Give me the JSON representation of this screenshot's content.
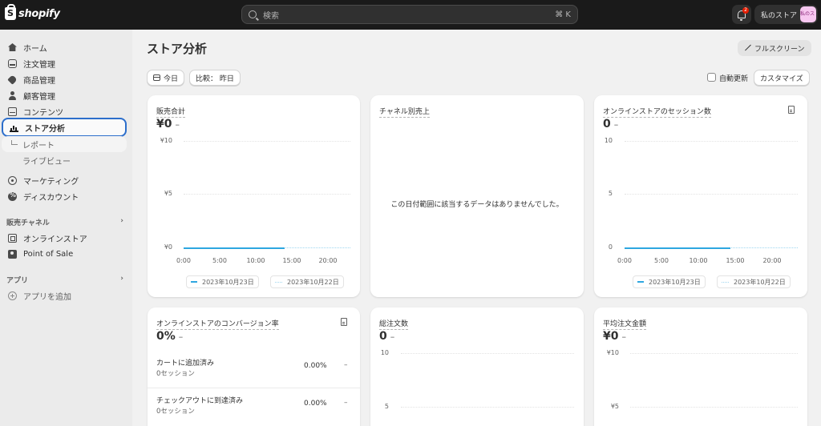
{
  "topbar": {
    "logo_text": "shopify",
    "search_placeholder": "検索",
    "search_shortcut": "⌘ K",
    "notification_count": "2",
    "store_name": "私のストア",
    "store_avatar": "私のストア"
  },
  "sidebar": {
    "items": [
      {
        "label": "ホーム",
        "icon": "home-icon"
      },
      {
        "label": "注文管理",
        "icon": "inbox-icon"
      },
      {
        "label": "商品管理",
        "icon": "tag-icon"
      },
      {
        "label": "顧客管理",
        "icon": "person-icon"
      },
      {
        "label": "コンテンツ",
        "icon": "content-icon"
      },
      {
        "label": "ストア分析",
        "icon": "chart-icon",
        "active": true
      }
    ],
    "sub_items": [
      {
        "label": "レポート"
      },
      {
        "label": "ライブビュー"
      }
    ],
    "items2": [
      {
        "label": "マーケティング",
        "icon": "target-icon"
      },
      {
        "label": "ディスカウント",
        "icon": "discount-icon"
      }
    ],
    "sales_channels_heading": "販売チャネル",
    "channels": [
      {
        "label": "オンラインストア",
        "icon": "store-icon"
      },
      {
        "label": "Point of Sale",
        "icon": "pos-icon"
      }
    ],
    "apps_heading": "アプリ",
    "add_app_label": "アプリを追加"
  },
  "page": {
    "title": "ストア分析",
    "fullscreen_label": "フルスクリーン",
    "today_label": "今日",
    "compare_label": "比較： 昨日",
    "auto_refresh_label": "自動更新",
    "customize_label": "カスタマイズ"
  },
  "cards": {
    "total_sales": {
      "title": "販売合計",
      "value": "¥0",
      "change": "–",
      "y_ticks": [
        "¥10",
        "¥5",
        "¥0"
      ],
      "x_ticks": [
        "0:00",
        "5:00",
        "10:00",
        "15:00",
        "20:00"
      ],
      "legend_current": "2023年10月23日",
      "legend_previous": "2023年10月22日"
    },
    "sales_by_channel": {
      "title": "チャネル別売上",
      "empty_message": "この日付範囲に該当するデータはありませんでした。"
    },
    "online_sessions": {
      "title": "オンラインストアのセッション数",
      "value": "0",
      "change": "–",
      "y_ticks": [
        "10",
        "5",
        "0"
      ],
      "x_ticks": [
        "0:00",
        "5:00",
        "10:00",
        "15:00",
        "20:00"
      ],
      "legend_current": "2023年10月23日",
      "legend_previous": "2023年10月22日"
    },
    "conversion": {
      "title": "オンラインストアのコンバージョン率",
      "value": "0%",
      "change": "–",
      "rows": [
        {
          "label": "カートに追加済み",
          "sub": "0セッション",
          "pct": "0.00%",
          "change": "–"
        },
        {
          "label": "チェックアウトに到達済み",
          "sub": "0セッション",
          "pct": "0.00%",
          "change": "–"
        }
      ]
    },
    "total_orders": {
      "title": "総注文数",
      "value": "0",
      "change": "–",
      "y_ticks": [
        "10",
        "5"
      ]
    },
    "avg_order_value": {
      "title": "平均注文金額",
      "value": "¥0",
      "change": "–",
      "y_ticks": [
        "¥10",
        "¥5"
      ]
    }
  },
  "colors": {
    "accent": "#2ea7e0",
    "active_outline": "#2c6ecb",
    "topbar": "#1a1a1a"
  }
}
